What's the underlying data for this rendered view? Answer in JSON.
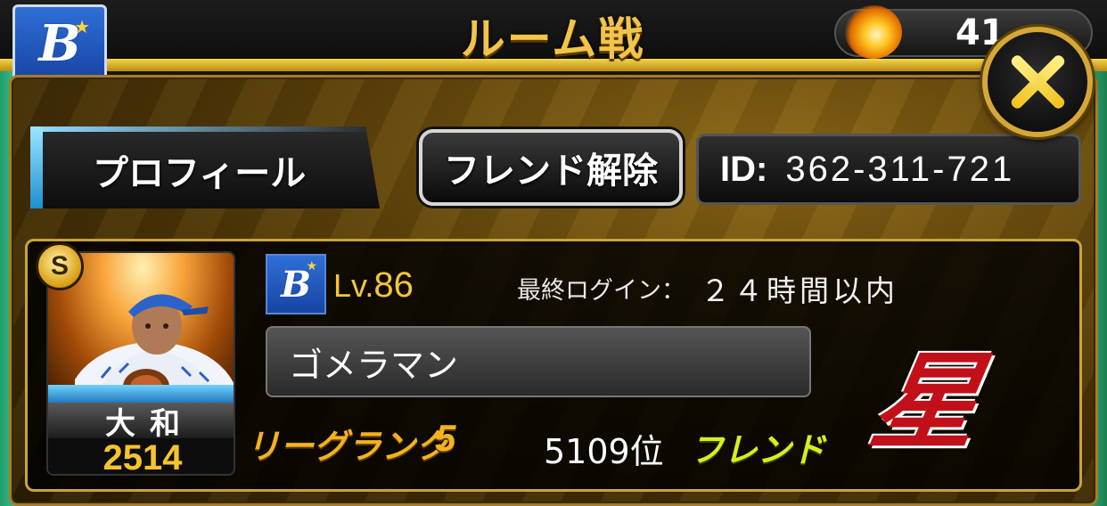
{
  "header": {
    "title": "ルーム戦",
    "team_logo": "B",
    "coin_value": "41",
    "coin_icon": "fireball-icon"
  },
  "dialog": {
    "profile_tab_label": "プロフィール",
    "unfriend_button_label": "フレンド解除",
    "id_label": "ID:",
    "id_value": "362-311-721",
    "close_icon": "close-icon"
  },
  "card": {
    "rank_badge": "S",
    "player_name": "大和",
    "player_power": "2514",
    "team_logo": "B",
    "level_prefix": "Lv.",
    "level_value": "86",
    "last_login_label": "最終ログイン：",
    "last_login_value": "２４時間以内",
    "user_name": "ゴメラマン",
    "league_rank_label": "リーグランク",
    "league_rank_value": "5",
    "ranking": "5109位",
    "friend_tag": "フレンド",
    "emblem_char": "星"
  },
  "colors": {
    "gold": "#caa43a",
    "league_rank": "#f3b21e",
    "friend": "#d4f01c",
    "team_blue": "#1744a4"
  }
}
